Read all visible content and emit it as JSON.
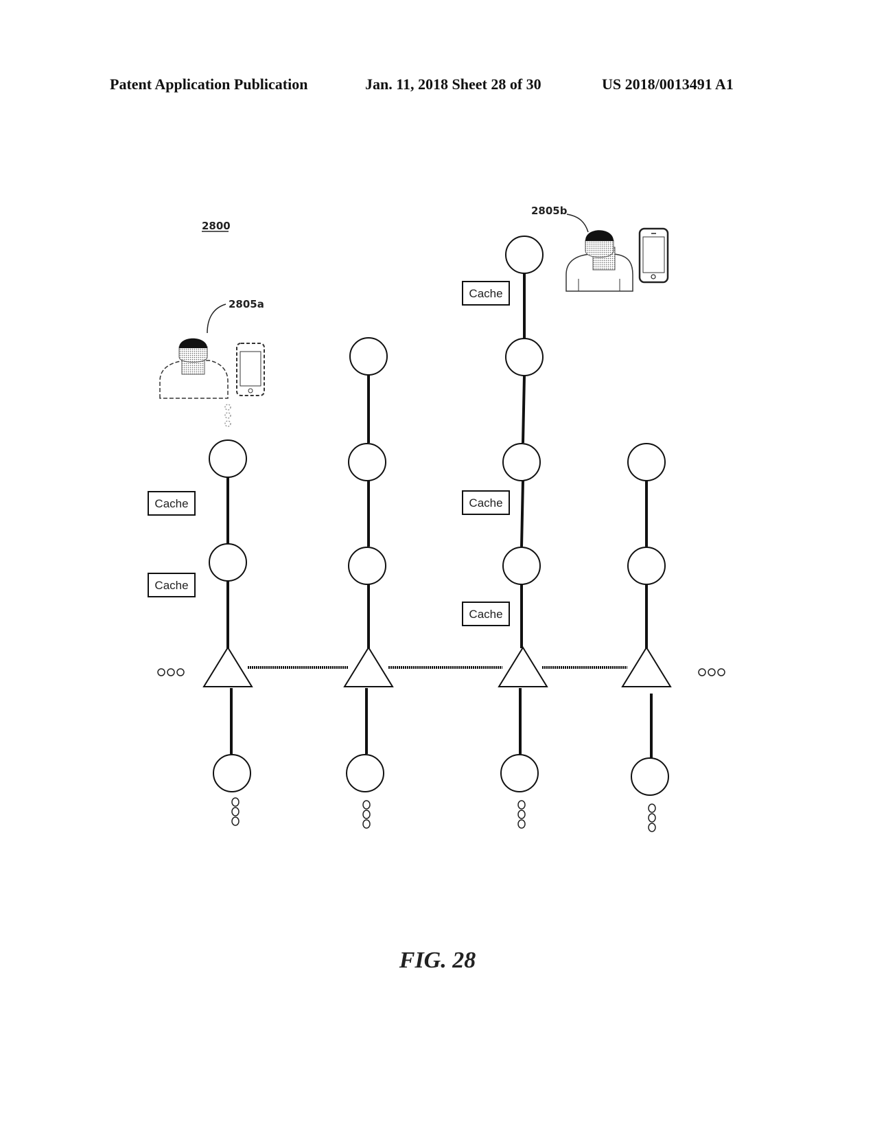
{
  "header": {
    "left": "Patent Application Publication",
    "date_sheet": "Jan. 11, 2018  Sheet 28 of 30",
    "number": "US 2018/0013491 A1"
  },
  "figure": {
    "ref_main": "2800",
    "ref_user_a": "2805a",
    "ref_user_b": "2805b",
    "cache_label": "Cache",
    "ellipsis": "ooo",
    "caption": "FIG. 28"
  },
  "columns": [
    {
      "upper_nodes": 2,
      "cache_count": 2,
      "user": "2805a"
    },
    {
      "upper_nodes": 3,
      "cache_count": 0
    },
    {
      "upper_nodes": 4,
      "cache_count": 3,
      "user": "2805b"
    },
    {
      "upper_nodes": 2,
      "cache_count": 0
    }
  ]
}
